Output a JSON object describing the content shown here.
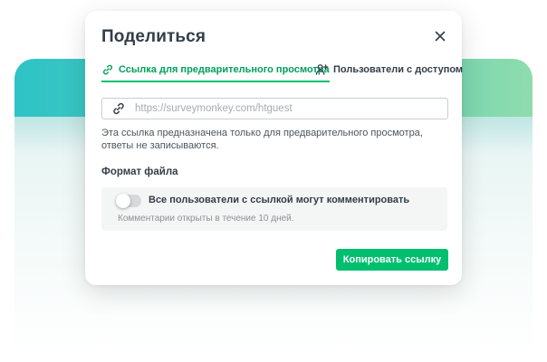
{
  "modal": {
    "title": "Поделиться",
    "close_icon": "close-icon"
  },
  "tabs": [
    {
      "label": "Ссылка для предварительного просмотра",
      "icon": "link-icon",
      "active": true
    },
    {
      "label": "Пользователи с доступом",
      "icon": "add-user-icon",
      "active": false
    }
  ],
  "url_field": {
    "value": "",
    "placeholder": "https://surveymonkey.com/htguest",
    "icon": "link-icon"
  },
  "description": "Эта ссылка предназначена только для предварительного просмотра, ответы не записываются.",
  "file_format": {
    "label": "Формат файла"
  },
  "comments": {
    "toggle_on": false,
    "label": "Все пользователи с ссылкой могут комментировать",
    "hint": "Комментарии открыты в течение 10 дней."
  },
  "copy_button": {
    "label": "Копировать ссылку"
  },
  "colors": {
    "accent": "#00bf6f",
    "accent_text": "#00a05a",
    "text_primary": "#333e48",
    "background_band_start": "#2ec3c6",
    "background_band_end": "#8fdcae"
  }
}
